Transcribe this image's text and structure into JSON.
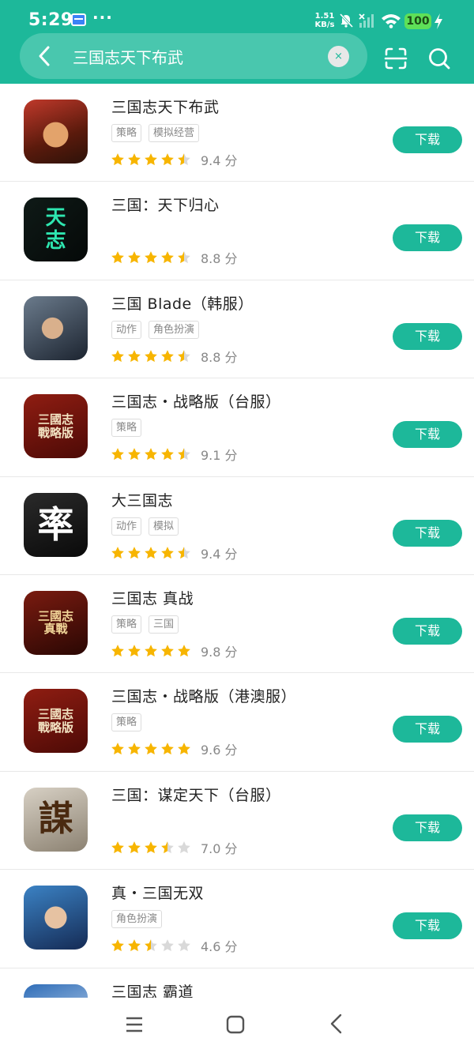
{
  "status_bar": {
    "time": "5:29",
    "more": "···",
    "speed_value": "1.51",
    "speed_unit": "KB/s",
    "battery": "100"
  },
  "search": {
    "query": "三国志天下布武",
    "clear_label": "×"
  },
  "colors": {
    "accent": "#1db89a",
    "star_filled": "#f7b500",
    "star_empty": "#d9d9d9"
  },
  "apps": [
    {
      "name": "三国志天下布武",
      "tags": [
        "策略",
        "模拟经营"
      ],
      "stars": 4.5,
      "score": "9.4 分",
      "button": "下载",
      "icon": "general-portrait-icon"
    },
    {
      "name": "三国：天下归心",
      "tags": [],
      "stars": 4.5,
      "score": "8.8 分",
      "button": "下载",
      "icon": "calligraphy-logo-icon"
    },
    {
      "name": "三国 Blade（韩服）",
      "tags": [
        "动作",
        "角色扮演"
      ],
      "stars": 4.5,
      "score": "8.8 分",
      "button": "下载",
      "icon": "warrior-portrait-icon"
    },
    {
      "name": "三国志・战略版（台服）",
      "tags": [
        "策略"
      ],
      "stars": 4.5,
      "score": "9.1 分",
      "button": "下载",
      "icon": "strategy-logo-icon"
    },
    {
      "name": "大三国志",
      "tags": [
        "动作",
        "模拟"
      ],
      "stars": 4.5,
      "score": "9.4 分",
      "button": "下载",
      "icon": "infinite-borders-icon"
    },
    {
      "name": "三国志 真战",
      "tags": [
        "策略",
        "三国"
      ],
      "stars": 5,
      "score": "9.8 分",
      "button": "下载",
      "icon": "zhenzhan-logo-icon"
    },
    {
      "name": "三国志・战略版（港澳服）",
      "tags": [
        "策略"
      ],
      "stars": 5,
      "score": "9.6 分",
      "button": "下载",
      "icon": "strategy-logo-icon"
    },
    {
      "name": "三国：谋定天下（台服）",
      "tags": [],
      "stars": 3.5,
      "score": "7.0 分",
      "button": "下载",
      "icon": "mou-logo-icon"
    },
    {
      "name": "真・三国无双",
      "tags": [
        "角色扮演"
      ],
      "stars": 2.5,
      "score": "4.6 分",
      "button": "下载",
      "icon": "hero-portrait-icon"
    },
    {
      "name": "三国志 霸道",
      "tags": [],
      "stars": 0,
      "score": "",
      "button": "",
      "icon": "badao-portrait-icon"
    }
  ]
}
